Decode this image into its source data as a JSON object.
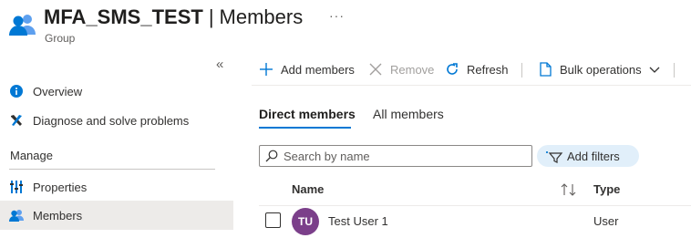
{
  "header": {
    "group_name": "MFA_SMS_TEST",
    "separator": "|",
    "section": "Members",
    "more": "···",
    "subtitle": "Group",
    "icon": "group-icon"
  },
  "sidebar": {
    "collapse_glyph": "«",
    "items": [
      {
        "label": "Overview",
        "icon": "info-icon"
      },
      {
        "label": "Diagnose and solve problems",
        "icon": "wrench-icon"
      },
      {
        "label": "Properties",
        "icon": "properties-icon"
      },
      {
        "label": "Members",
        "icon": "members-icon",
        "selected": true
      }
    ],
    "manage_header": "Manage"
  },
  "toolbar": {
    "add_members": "Add members",
    "remove": "Remove",
    "refresh": "Refresh",
    "bulk_operations": "Bulk operations"
  },
  "tabs": {
    "direct_members": "Direct members",
    "all_members": "All members"
  },
  "search": {
    "placeholder": "Search by name",
    "value": ""
  },
  "filters": {
    "add_filters": "Add filters"
  },
  "table": {
    "columns": [
      "Name",
      "Type"
    ],
    "rows": [
      {
        "initials": "TU",
        "name": "Test User 1",
        "type": "User"
      }
    ]
  },
  "colors": {
    "accent": "#0078d4",
    "avatar": "#7b3f8a",
    "selected_nav": "#edebe9",
    "filter_pill": "#e1effa"
  }
}
